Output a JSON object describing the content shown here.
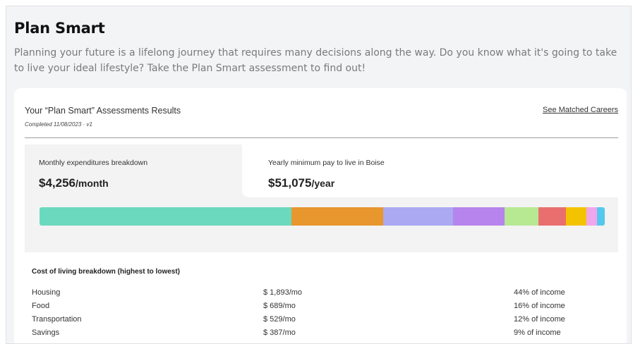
{
  "page": {
    "title": "Plan Smart",
    "intro": "Planning your future is a lifelong journey that requires many decisions along the way. Do you know what it's going to take to live your ideal lifestyle? Take the Plan Smart assessment to find out!"
  },
  "results": {
    "title": "Your “Plan Smart” Assessments Results",
    "completed": "Completed 11/08/2023 · v1",
    "see_matched_careers": "See Matched Careers"
  },
  "tabs": [
    {
      "label": "Monthly expenditures breakdown",
      "amount": "$4,256",
      "unit": "/month"
    },
    {
      "label": "Yearly minimum pay to live in Boise",
      "amount": "$51,075",
      "unit": "/year"
    }
  ],
  "bar_segments": [
    {
      "color": "#6bd9be",
      "share": 44.6
    },
    {
      "color": "#e8962e",
      "share": 16.2
    },
    {
      "color": "#aaa9f2",
      "share": 12.4
    },
    {
      "color": "#b783ec",
      "share": 9.1
    },
    {
      "color": "#b7e892",
      "share": 5.9
    },
    {
      "color": "#e96f6e",
      "share": 4.9
    },
    {
      "color": "#f4c300",
      "share": 3.7
    },
    {
      "color": "#f0a6ea",
      "share": 1.8
    },
    {
      "color": "#55c8ee",
      "share": 1.4
    }
  ],
  "breakdown": {
    "title": "Cost of living breakdown (highest to lowest)",
    "rows": [
      {
        "category": "Housing",
        "amount": "$ 1,893/mo",
        "percent": "44% of income"
      },
      {
        "category": "Food",
        "amount": "$ 689/mo",
        "percent": "16% of income"
      },
      {
        "category": "Transportation",
        "amount": "$ 529/mo",
        "percent": "12% of income"
      },
      {
        "category": "Savings",
        "amount": "$ 387/mo",
        "percent": "9% of income"
      }
    ]
  }
}
